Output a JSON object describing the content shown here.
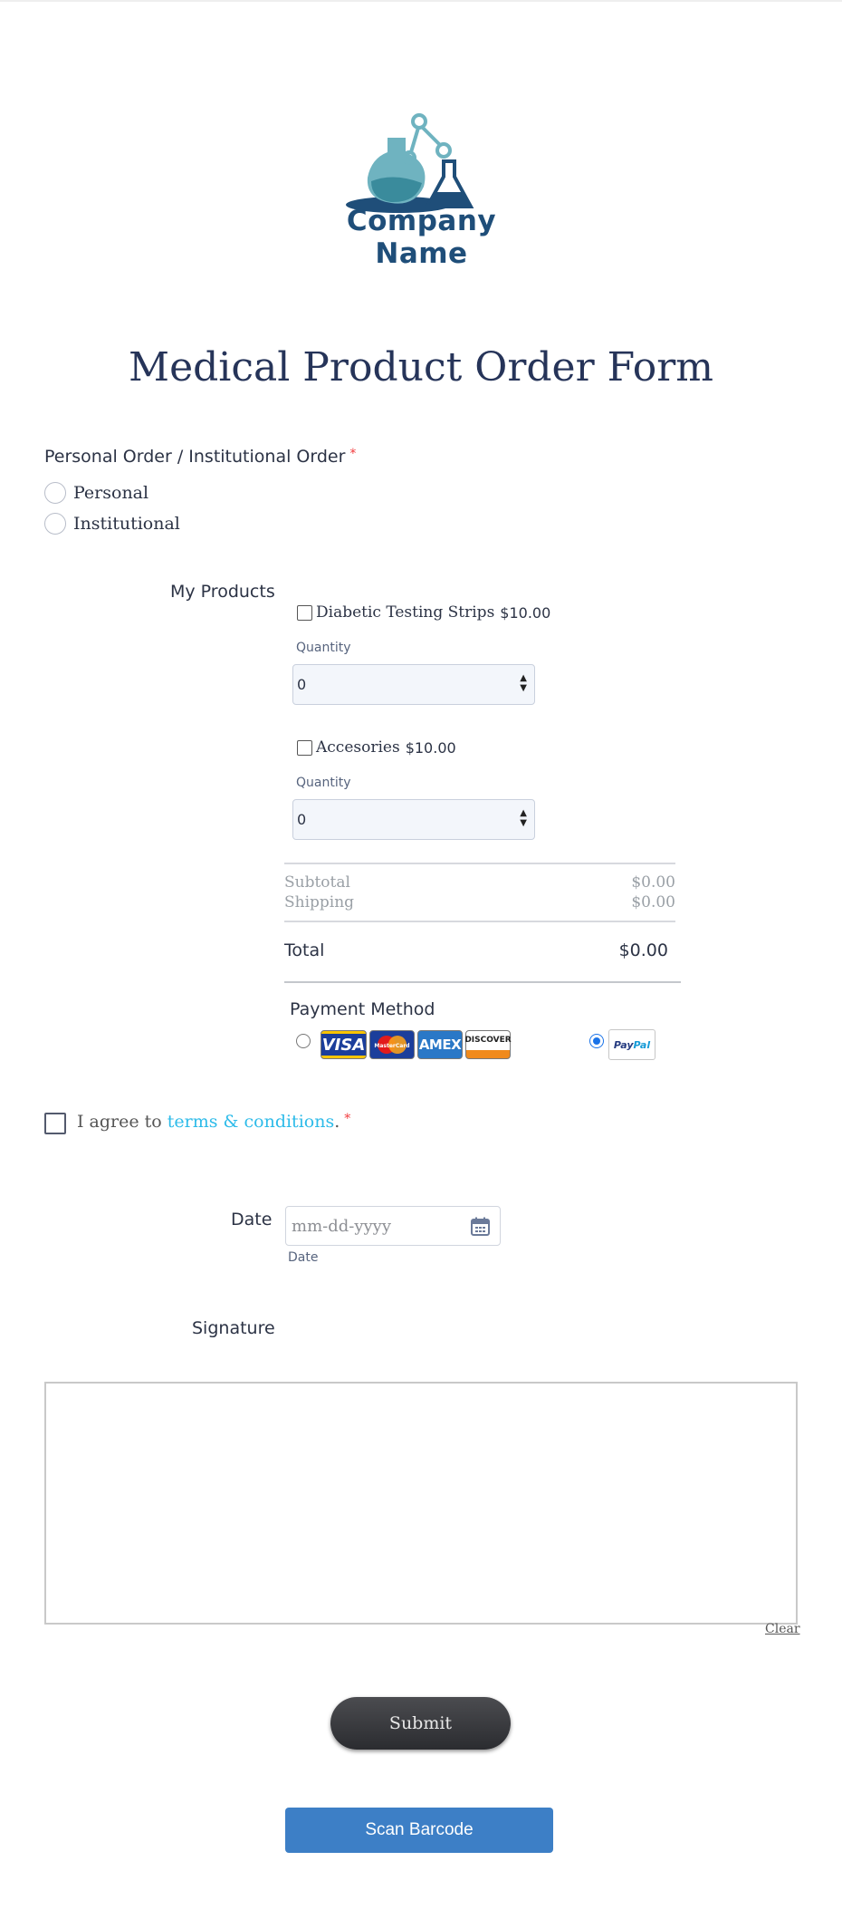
{
  "logo": {
    "company_name": "Company Name",
    "icon": "lab-flasks-logo"
  },
  "form": {
    "title": "Medical Product Order Form"
  },
  "order_type": {
    "label": "Personal Order / Institutional Order",
    "required_mark": "*",
    "options": [
      "Personal",
      "Institutional"
    ]
  },
  "products": {
    "label": "My Products",
    "items": [
      {
        "name": "Diabetic Testing Strips",
        "price": "$10.00",
        "quantity_label": "Quantity",
        "quantity": "0",
        "checked": false
      },
      {
        "name": "Accesories",
        "price": "$10.00",
        "quantity_label": "Quantity",
        "quantity": "0",
        "checked": false
      }
    ],
    "subtotal_label": "Subtotal",
    "subtotal_value": "$0.00",
    "shipping_label": "Shipping",
    "shipping_value": "$0.00",
    "total_label": "Total",
    "total_value": "$0.00"
  },
  "payment": {
    "label": "Payment Method",
    "cards": [
      "VISA",
      "MasterCard",
      "AMEX",
      "DISCOVER"
    ],
    "paypal_pay": "Pay",
    "paypal_pal": "Pal",
    "selected": "paypal"
  },
  "terms": {
    "prefix": "I agree to",
    "link": "terms & conditions",
    "suffix": ".",
    "required_mark": "*"
  },
  "date": {
    "label": "Date",
    "placeholder": "mm-dd-yyyy",
    "sublabel": "Date"
  },
  "signature": {
    "label": "Signature",
    "clear_label": "Clear"
  },
  "buttons": {
    "submit": "Submit",
    "scan": "Scan Barcode"
  },
  "colors": {
    "title": "#263459",
    "accent_link": "#2dbbe9",
    "required": "#f23a3c",
    "scan_button": "#3d7fc6",
    "submit_button": "#2b2c30"
  }
}
